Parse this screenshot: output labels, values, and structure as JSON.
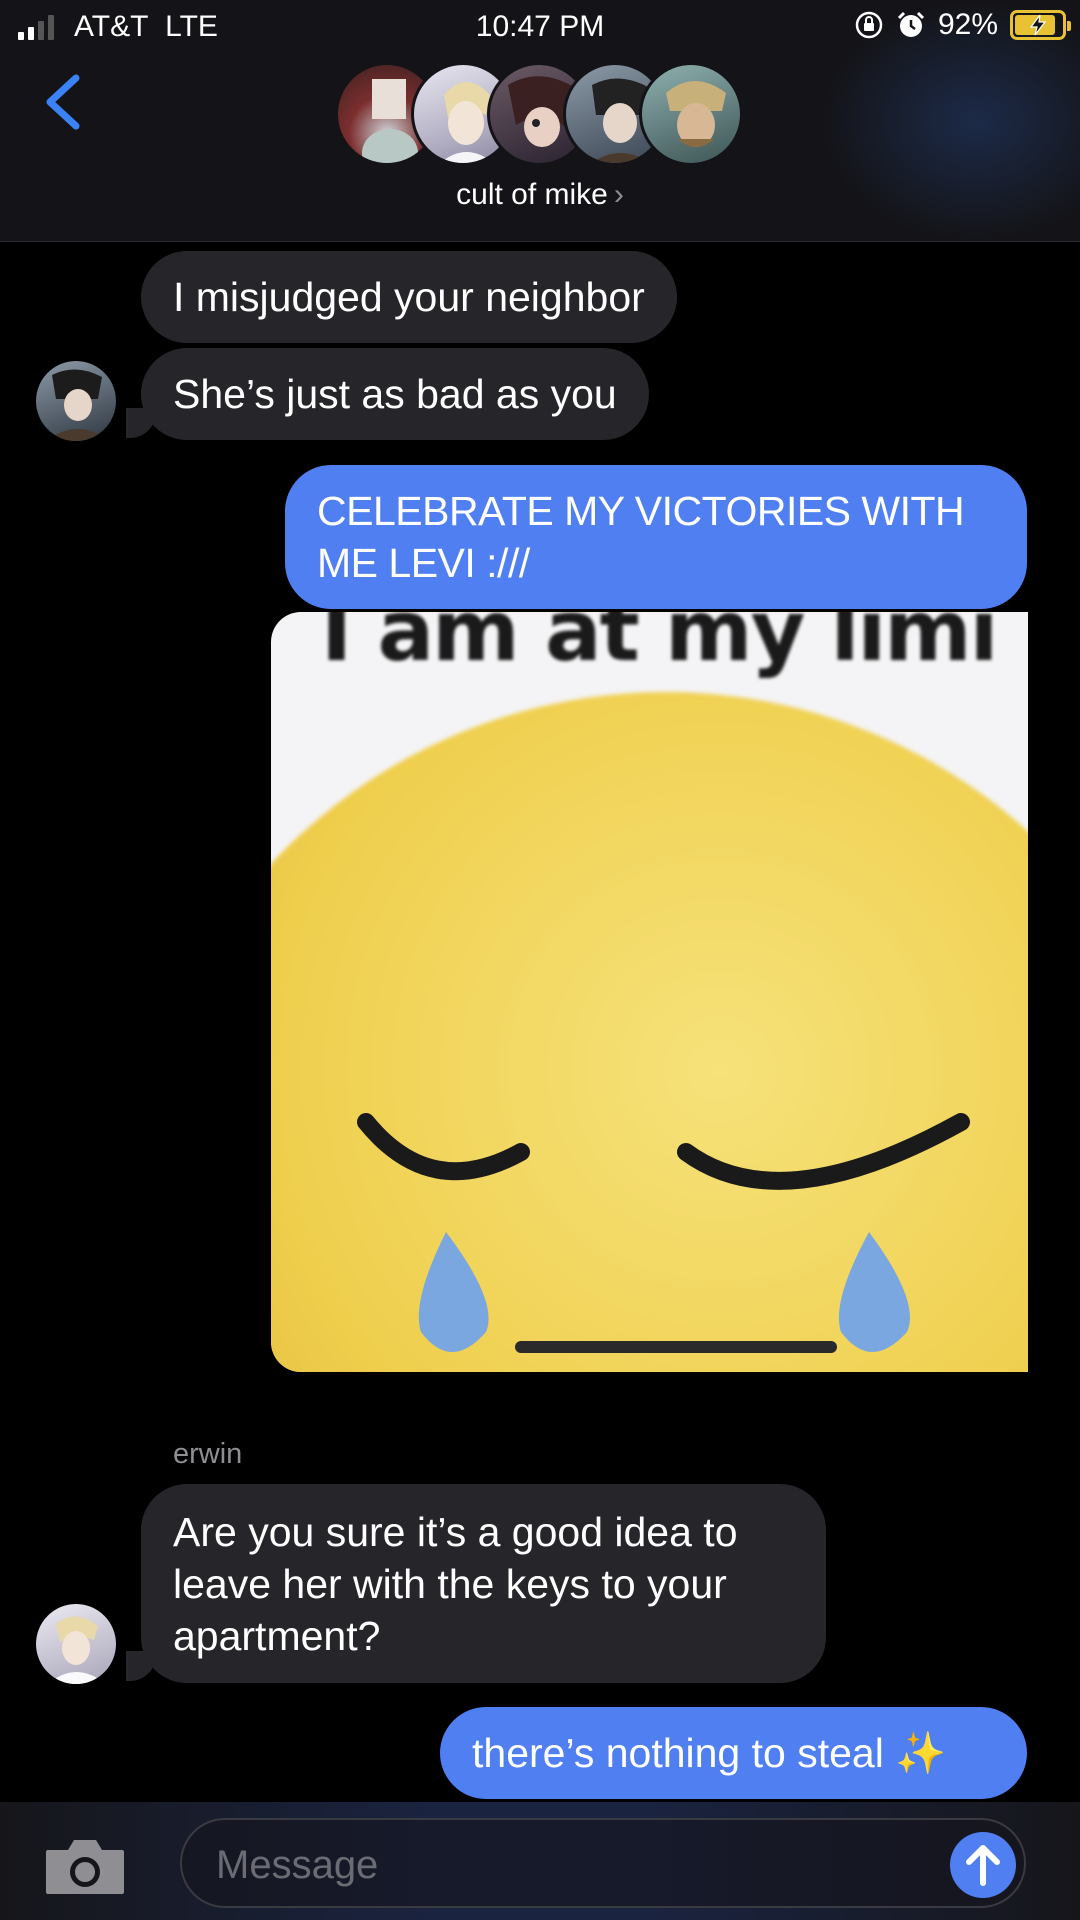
{
  "status": {
    "carrier": "AT&T",
    "network": "LTE",
    "time": "10:47 PM",
    "battery_percent": "92%",
    "signal_bars_active": 2,
    "signal_bars_total": 4
  },
  "header": {
    "group_name": "cult of mike",
    "chevron": "›",
    "member_avatars": [
      "avatar-1",
      "avatar-2",
      "avatar-3",
      "avatar-4",
      "avatar-5"
    ]
  },
  "messages": [
    {
      "direction": "incoming",
      "text": "I misjudged your neighbor"
    },
    {
      "direction": "incoming",
      "text": "She’s just as bad as you"
    },
    {
      "direction": "outgoing",
      "lines": [
        "CELEBRATE MY VICTORIES WITH",
        "ME LEVI :///"
      ]
    },
    {
      "direction": "outgoing",
      "type": "image",
      "caption_text": "I am at my limi"
    },
    {
      "direction": "incoming",
      "sender": "erwin",
      "lines": [
        "Are you sure it’s a good idea to",
        "leave her with the keys to your",
        "apartment?"
      ]
    },
    {
      "direction": "outgoing",
      "text": "there’s nothing to steal ✨"
    }
  ],
  "compose": {
    "placeholder": "Message"
  },
  "colors": {
    "outgoing_bubble": "#4f7ff0",
    "incoming_bubble": "#26252a",
    "accent": "#3b82f6",
    "battery": "#e8c233"
  },
  "icons": {
    "back": "chevron-left-icon",
    "camera": "camera-icon",
    "send": "arrow-up-icon",
    "orientation_lock": "orientation-lock-icon",
    "alarm": "alarm-icon",
    "battery": "battery-charging-icon"
  }
}
